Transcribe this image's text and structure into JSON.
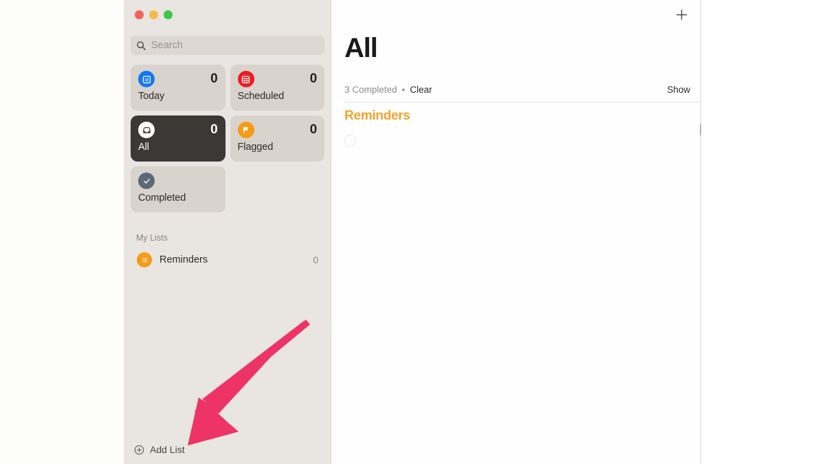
{
  "window": {
    "traffic_lights": [
      {
        "name": "close",
        "color": "#f2635b"
      },
      {
        "name": "minimize",
        "color": "#f3bb4c"
      },
      {
        "name": "maximize",
        "color": "#3cc84a"
      }
    ]
  },
  "sidebar": {
    "search": {
      "placeholder": "Search",
      "value": "",
      "icon": "search-icon"
    },
    "smart_lists": [
      {
        "id": "today",
        "label": "Today",
        "count": "0",
        "icon": "calendar-day-icon",
        "icon_color": "#1479f0",
        "selected": false
      },
      {
        "id": "scheduled",
        "label": "Scheduled",
        "count": "0",
        "icon": "calendar-icon",
        "icon_color": "#ec1c24",
        "selected": false
      },
      {
        "id": "all",
        "label": "All",
        "count": "0",
        "icon": "inbox-tray-icon",
        "icon_color": "#ffffff",
        "selected": true
      },
      {
        "id": "flagged",
        "label": "Flagged",
        "count": "0",
        "icon": "flag-icon",
        "icon_color": "#f59b17",
        "selected": false
      },
      {
        "id": "completed",
        "label": "Completed",
        "count": "",
        "icon": "checkmark-icon",
        "icon_color": "#5b6a76",
        "selected": false
      }
    ],
    "my_lists": {
      "header": "My Lists",
      "items": [
        {
          "name": "Reminders",
          "count": "0",
          "icon": "bulleted-list-icon",
          "icon_color": "#f59b17"
        }
      ]
    },
    "add_list": {
      "label": "Add List",
      "icon": "circle-plus-icon"
    }
  },
  "content": {
    "add_reminder_icon": "plus-icon",
    "title": "All",
    "meta": {
      "completed": "3 Completed",
      "separator": "•",
      "clear": "Clear",
      "show": "Show"
    },
    "section_title": "Reminders",
    "reminder_placeholder_icon": "empty-circle-icon"
  },
  "annotation": {
    "arrow": {
      "name": "pink-pointer-arrow",
      "color": "#ee3366",
      "points_to": "Add List"
    }
  },
  "colors": {
    "sidebar_bg": "#e9e5e1",
    "card_bg": "#d9d3cd",
    "card_selected_bg": "#3b3835",
    "content_bg": "#fefefe",
    "accent_orange": "#f0a32a",
    "arrow_pink": "#ee3366"
  }
}
